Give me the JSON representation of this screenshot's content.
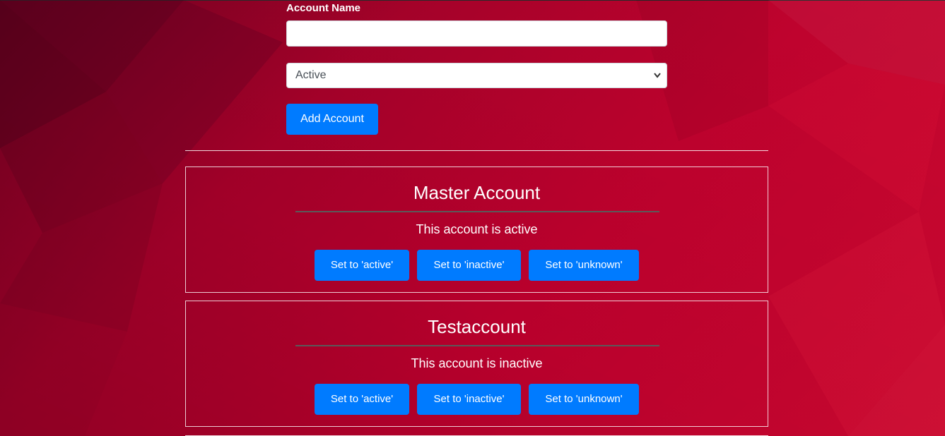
{
  "form": {
    "account_name_label": "Account Name",
    "account_name_value": "",
    "status_select_value": "Active",
    "add_button_label": "Add Account"
  },
  "accounts": [
    {
      "name": "Master Account",
      "status_text": "This account is active",
      "buttons": [
        "Set to 'active'",
        "Set to 'inactive'",
        "Set to 'unknown'"
      ]
    },
    {
      "name": "Testaccount",
      "status_text": "This account is inactive",
      "buttons": [
        "Set to 'active'",
        "Set to 'inactive'",
        "Set to 'unknown'"
      ]
    }
  ],
  "colors": {
    "primary_button": "#007bff",
    "background": "#b8002c"
  },
  "icons": {
    "select_arrow": "chevron-down-icon"
  }
}
